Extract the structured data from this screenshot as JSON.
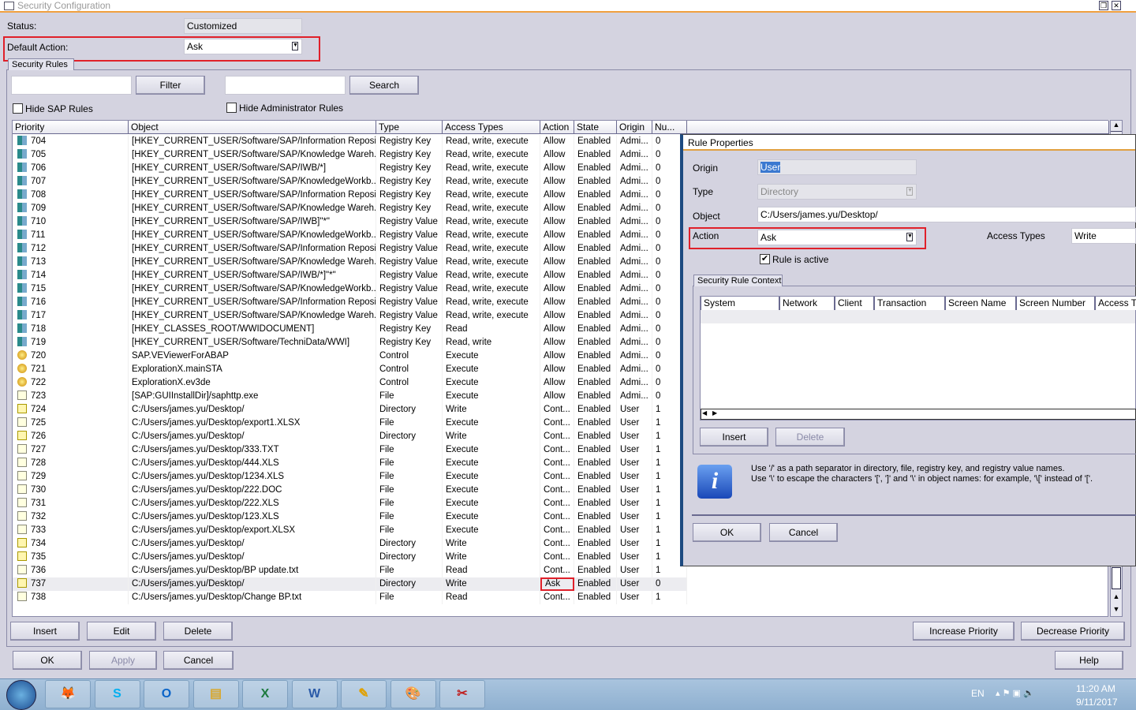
{
  "window": {
    "title": "Security Configuration",
    "restore": "❐",
    "close": "✕"
  },
  "header": {
    "status_label": "Status:",
    "status_value": "Customized",
    "default_action_label": "Default Action:",
    "default_action_value": "Ask"
  },
  "tab": "Security Rules",
  "filter": {
    "input": "",
    "button": "Filter",
    "search_input": "",
    "search_button": "Search",
    "hide_sap": "Hide SAP Rules",
    "hide_admin": "Hide Administrator Rules"
  },
  "columns": [
    "Priority",
    "Object",
    "Type",
    "Access Types",
    "Action",
    "State",
    "Origin",
    "Nu..."
  ],
  "rows": [
    [
      "704",
      "[HKEY_CURRENT_USER/Software/SAP/Information Reposi...",
      "Registry Key",
      "Read, write, execute",
      "Allow",
      "Enabled",
      "Admi...",
      "0",
      "reg"
    ],
    [
      "705",
      "[HKEY_CURRENT_USER/Software/SAP/Knowledge Wareh...",
      "Registry Key",
      "Read, write, execute",
      "Allow",
      "Enabled",
      "Admi...",
      "0",
      "reg"
    ],
    [
      "706",
      "[HKEY_CURRENT_USER/Software/SAP/IWB/*]",
      "Registry Key",
      "Read, write, execute",
      "Allow",
      "Enabled",
      "Admi...",
      "0",
      "reg"
    ],
    [
      "707",
      "[HKEY_CURRENT_USER/Software/SAP/KnowledgeWorkb...",
      "Registry Key",
      "Read, write, execute",
      "Allow",
      "Enabled",
      "Admi...",
      "0",
      "reg"
    ],
    [
      "708",
      "[HKEY_CURRENT_USER/Software/SAP/Information Reposi...",
      "Registry Key",
      "Read, write, execute",
      "Allow",
      "Enabled",
      "Admi...",
      "0",
      "reg"
    ],
    [
      "709",
      "[HKEY_CURRENT_USER/Software/SAP/Knowledge Wareh...",
      "Registry Key",
      "Read, write, execute",
      "Allow",
      "Enabled",
      "Admi...",
      "0",
      "reg"
    ],
    [
      "710",
      "[HKEY_CURRENT_USER/Software/SAP/IWB]\"*\"",
      "Registry Value",
      "Read, write, execute",
      "Allow",
      "Enabled",
      "Admi...",
      "0",
      "reg"
    ],
    [
      "711",
      "[HKEY_CURRENT_USER/Software/SAP/KnowledgeWorkb...",
      "Registry Value",
      "Read, write, execute",
      "Allow",
      "Enabled",
      "Admi...",
      "0",
      "reg"
    ],
    [
      "712",
      "[HKEY_CURRENT_USER/Software/SAP/Information Reposi...",
      "Registry Value",
      "Read, write, execute",
      "Allow",
      "Enabled",
      "Admi...",
      "0",
      "reg"
    ],
    [
      "713",
      "[HKEY_CURRENT_USER/Software/SAP/Knowledge Wareh...",
      "Registry Value",
      "Read, write, execute",
      "Allow",
      "Enabled",
      "Admi...",
      "0",
      "reg"
    ],
    [
      "714",
      "[HKEY_CURRENT_USER/Software/SAP/IWB/*]\"*\"",
      "Registry Value",
      "Read, write, execute",
      "Allow",
      "Enabled",
      "Admi...",
      "0",
      "reg"
    ],
    [
      "715",
      "[HKEY_CURRENT_USER/Software/SAP/KnowledgeWorkb...",
      "Registry Value",
      "Read, write, execute",
      "Allow",
      "Enabled",
      "Admi...",
      "0",
      "reg"
    ],
    [
      "716",
      "[HKEY_CURRENT_USER/Software/SAP/Information Reposi...",
      "Registry Value",
      "Read, write, execute",
      "Allow",
      "Enabled",
      "Admi...",
      "0",
      "reg"
    ],
    [
      "717",
      "[HKEY_CURRENT_USER/Software/SAP/Knowledge Wareh...",
      "Registry Value",
      "Read, write, execute",
      "Allow",
      "Enabled",
      "Admi...",
      "0",
      "reg"
    ],
    [
      "718",
      "[HKEY_CLASSES_ROOT/WWIDOCUMENT]",
      "Registry Key",
      "Read",
      "Allow",
      "Enabled",
      "Admi...",
      "0",
      "reg"
    ],
    [
      "719",
      "[HKEY_CURRENT_USER/Software/TechniData/WWI]",
      "Registry Key",
      "Read, write",
      "Allow",
      "Enabled",
      "Admi...",
      "0",
      "reg"
    ],
    [
      "720",
      "SAP.VEViewerForABAP",
      "Control",
      "Execute",
      "Allow",
      "Enabled",
      "Admi...",
      "0",
      "ctl"
    ],
    [
      "721",
      "ExplorationX.mainSTA",
      "Control",
      "Execute",
      "Allow",
      "Enabled",
      "Admi...",
      "0",
      "ctl"
    ],
    [
      "722",
      "ExplorationX.ev3de",
      "Control",
      "Execute",
      "Allow",
      "Enabled",
      "Admi...",
      "0",
      "ctl"
    ],
    [
      "723",
      "[SAP:GUIInstallDir]/saphttp.exe",
      "File",
      "Execute",
      "Allow",
      "Enabled",
      "Admi...",
      "0",
      "file"
    ],
    [
      "724",
      "C:/Users/james.yu/Desktop/",
      "Directory",
      "Write",
      "Cont...",
      "Enabled",
      "User",
      "1",
      "dir"
    ],
    [
      "725",
      "C:/Users/james.yu/Desktop/export1.XLSX",
      "File",
      "Execute",
      "Cont...",
      "Enabled",
      "User",
      "1",
      "file"
    ],
    [
      "726",
      "C:/Users/james.yu/Desktop/",
      "Directory",
      "Write",
      "Cont...",
      "Enabled",
      "User",
      "1",
      "dir"
    ],
    [
      "727",
      "C:/Users/james.yu/Desktop/333.TXT",
      "File",
      "Execute",
      "Cont...",
      "Enabled",
      "User",
      "1",
      "file"
    ],
    [
      "728",
      "C:/Users/james.yu/Desktop/444.XLS",
      "File",
      "Execute",
      "Cont...",
      "Enabled",
      "User",
      "1",
      "file"
    ],
    [
      "729",
      "C:/Users/james.yu/Desktop/1234.XLS",
      "File",
      "Execute",
      "Cont...",
      "Enabled",
      "User",
      "1",
      "file"
    ],
    [
      "730",
      "C:/Users/james.yu/Desktop/222.DOC",
      "File",
      "Execute",
      "Cont...",
      "Enabled",
      "User",
      "1",
      "file"
    ],
    [
      "731",
      "C:/Users/james.yu/Desktop/222.XLS",
      "File",
      "Execute",
      "Cont...",
      "Enabled",
      "User",
      "1",
      "file"
    ],
    [
      "732",
      "C:/Users/james.yu/Desktop/123.XLS",
      "File",
      "Execute",
      "Cont...",
      "Enabled",
      "User",
      "1",
      "file"
    ],
    [
      "733",
      "C:/Users/james.yu/Desktop/export.XLSX",
      "File",
      "Execute",
      "Cont...",
      "Enabled",
      "User",
      "1",
      "file"
    ],
    [
      "734",
      "C:/Users/james.yu/Desktop/",
      "Directory",
      "Write",
      "Cont...",
      "Enabled",
      "User",
      "1",
      "dir"
    ],
    [
      "735",
      "C:/Users/james.yu/Desktop/",
      "Directory",
      "Write",
      "Cont...",
      "Enabled",
      "User",
      "1",
      "dir"
    ],
    [
      "736",
      "C:/Users/james.yu/Desktop/BP update.txt",
      "File",
      "Read",
      "Cont...",
      "Enabled",
      "User",
      "1",
      "file"
    ],
    [
      "737",
      "C:/Users/james.yu/Desktop/",
      "Directory",
      "Write",
      "Ask",
      "Enabled",
      "User",
      "0",
      "dir"
    ],
    [
      "738",
      "C:/Users/james.yu/Desktop/Change BP.txt",
      "File",
      "Read",
      "Cont...",
      "Enabled",
      "User",
      "1",
      "file"
    ]
  ],
  "selected_priority": "737",
  "bottom": {
    "insert": "Insert",
    "edit": "Edit",
    "delete": "Delete",
    "increase": "Increase Priority",
    "decrease": "Decrease Priority",
    "ok": "OK",
    "apply": "Apply",
    "cancel": "Cancel",
    "help": "Help"
  },
  "dialog": {
    "title": "Rule Properties",
    "origin_label": "Origin",
    "origin_value": "User",
    "type_label": "Type",
    "type_value": "Directory",
    "object_label": "Object",
    "object_value": "C:/Users/james.yu/Desktop/",
    "action_label": "Action",
    "action_value": "Ask",
    "access_label": "Access Types",
    "access_value": "Write",
    "rule_active": "Rule is active",
    "rule_active_checked": true,
    "context_tab": "Security Rule Context",
    "context_columns": [
      "System",
      "Network",
      "Client",
      "Transaction",
      "Screen Name",
      "Screen Number",
      "Access T"
    ],
    "insert": "Insert",
    "delete": "Delete",
    "info_line1": "Use '/' as a path separator in directory, file, registry key, and registry value names.",
    "info_line2": "Use '\\' to escape the characters '[', ']' and '\\' in object names: for example, '\\[' instead of '['.",
    "ok": "OK",
    "cancel": "Cancel"
  },
  "taskbar": {
    "apps": [
      "firefox",
      "skype",
      "outlook",
      "file-explorer",
      "excel",
      "word",
      "sap-logon",
      "paint",
      "snipping-tool"
    ],
    "language": "EN",
    "time": "11:20 AM",
    "date": "9/11/2017"
  },
  "colors": {
    "highlight": "#e0202a",
    "background": "#d4d3e0",
    "accent": "#f0a040"
  }
}
